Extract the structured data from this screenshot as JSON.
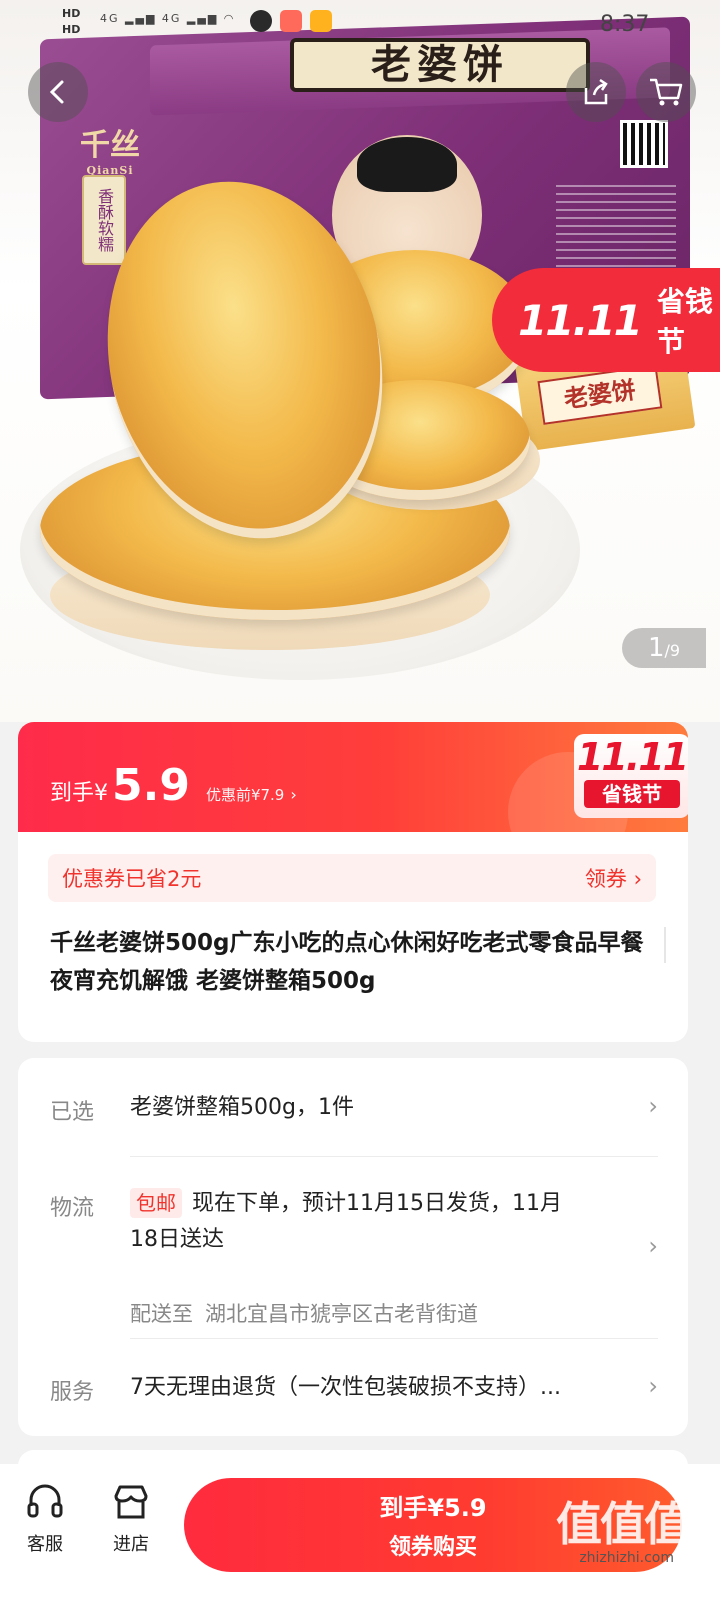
{
  "status_bar": {
    "hd1": "HD",
    "hd2": "HD",
    "signal1": "4G",
    "signal2": "4G",
    "time": "8:37"
  },
  "hero": {
    "box_label": "老婆饼",
    "brand": "千丝",
    "brand_sub": "QianSi",
    "box_tag": "香酥软糯",
    "pack_label": "老婆饼",
    "promo_flag": {
      "num": "11.11",
      "text": "省钱节"
    },
    "image_counter": {
      "current": "1",
      "total": "/9"
    }
  },
  "price_banner": {
    "prefix": "到手¥",
    "price": "5.9",
    "original": "优惠前¥7.9",
    "arrow": "›",
    "badge_num": "11.11",
    "badge_text": "省钱节"
  },
  "coupon": {
    "text": "优惠券已省2元",
    "link": "领券 ›"
  },
  "product": {
    "title": "千丝老婆饼500g广东小吃的点心休闲好吃老式零食品早餐夜宵充饥解饿 老婆饼整箱500g"
  },
  "info": {
    "selected": {
      "label": "已选",
      "value": "老婆饼整箱500g，1件"
    },
    "logistics": {
      "label": "物流",
      "badge": "包邮",
      "value_line1": "现在下单，预计11月15日发货，11月",
      "value_line2": "18日送达",
      "addr_label": "配送至",
      "addr_value": "湖北宜昌市猇亭区古老背街道"
    },
    "service": {
      "label": "服务",
      "value": "7天无理由退货（一次性包装破损不支持）..."
    },
    "chevron": "›"
  },
  "bottom_bar": {
    "service_label": "客服",
    "store_label": "进店",
    "buy_line1": "到手¥5.9",
    "buy_line2": "领券购买"
  },
  "watermark": {
    "big": "值值值",
    "small": "zhizhizhi.com"
  },
  "colors": {
    "accent_red": "#f0332c",
    "banner_red": "#ff2b4a",
    "box_purple": "#7e2f77"
  }
}
